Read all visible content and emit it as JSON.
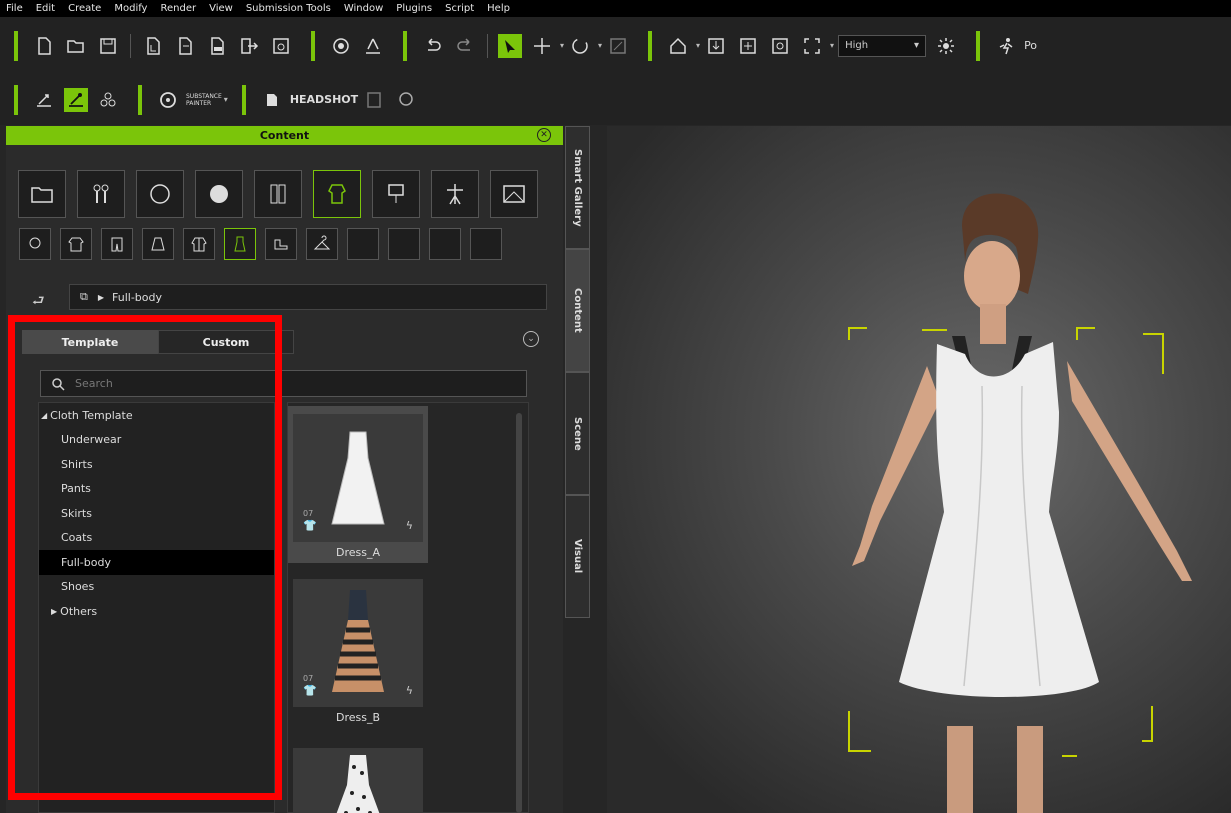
{
  "menu": [
    "File",
    "Edit",
    "Create",
    "Modify",
    "Render",
    "View",
    "Submission Tools",
    "Window",
    "Plugins",
    "Script",
    "Help"
  ],
  "toolbar": {
    "quality_select": "High",
    "substance_label": "SUBSTANCE\nPAINTER",
    "headshot_label": "HEADSHOT",
    "pose_label": "Po"
  },
  "content_panel": {
    "title": "Content",
    "path_label": "Full-body",
    "tabs": [
      {
        "label": "Template"
      },
      {
        "label": "Custom"
      }
    ],
    "search_placeholder": "Search",
    "tree": [
      {
        "label": "Cloth Template",
        "expander": "◢"
      },
      {
        "label": "Underwear"
      },
      {
        "label": "Shirts"
      },
      {
        "label": "Pants"
      },
      {
        "label": "Skirts"
      },
      {
        "label": "Coats"
      },
      {
        "label": "Full-body"
      },
      {
        "label": "Shoes"
      },
      {
        "label": "Others",
        "expander": "▶"
      }
    ],
    "items": [
      {
        "label": "Dress_A",
        "count": "07"
      },
      {
        "label": "Dress_B",
        "count": "07"
      }
    ]
  },
  "side_tabs": [
    "Smart Gallery",
    "Content",
    "Scene",
    "Visual"
  ],
  "colors": {
    "accent": "#7bc50a",
    "highlight": "#ff0000"
  }
}
